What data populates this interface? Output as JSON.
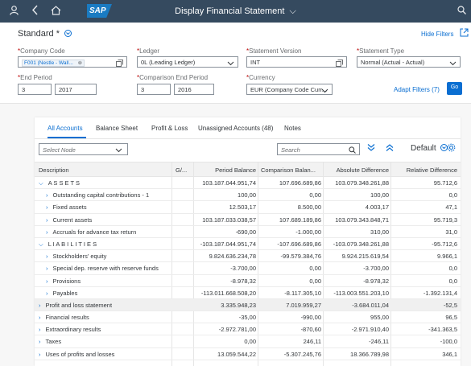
{
  "shell": {
    "title": "Display Financial Statement",
    "title_chevron": "⌵",
    "logo_text": "SAP",
    "icons": {
      "user": "user-icon",
      "back": "back-icon",
      "home": "home-icon",
      "search": "search-icon"
    }
  },
  "page": {
    "title": "Standard *",
    "title_dropdown": "⌵",
    "hide_filters": "Hide Filters",
    "share_icon": "share-icon"
  },
  "filters": {
    "company_code": {
      "label": "Company Code",
      "value": "F001 (Nestle - Wall...",
      "token_close": "⊗"
    },
    "ledger": {
      "label": "Ledger",
      "value": "0L (Leading Ledger)"
    },
    "statement_version": {
      "label": "Statement Version",
      "value": "INT"
    },
    "statement_type": {
      "label": "Statement Type",
      "value": "Normal (Actual - Actual)"
    },
    "end_period": {
      "label": "End Period",
      "period": "3",
      "year": "2017"
    },
    "comparison_end_period": {
      "label": "Comparison End Period",
      "period": "3",
      "year": "2016"
    },
    "currency": {
      "label": "Currency",
      "value": "EUR (Company Code Curr..."
    },
    "adapt_filters": "Adapt Filters (7)",
    "go": "Go",
    "required_mark": "*"
  },
  "tabs": [
    {
      "label": "All Accounts",
      "active": true
    },
    {
      "label": "Balance Sheet",
      "active": false
    },
    {
      "label": "Profit & Loss",
      "active": false
    },
    {
      "label": "Unassigned Accounts (48)",
      "active": false
    },
    {
      "label": "Notes",
      "active": false
    }
  ],
  "toolbar": {
    "select_node_placeholder": "Select Node",
    "search_placeholder": "Search",
    "variant": "Default",
    "glyphs": {
      "dropdown": "⌵",
      "search": "⌕",
      "expand_all": "⌄",
      "collapse_all": "⌃",
      "settings": "⚙",
      "variant_dd": "⊙"
    }
  },
  "table": {
    "columns": [
      "Description",
      "G/...",
      "Period Balance",
      "Comparison Balan...",
      "Absolute Difference",
      "Relative Difference"
    ],
    "rows": [
      {
        "desc": "A S S E T S",
        "level": 0,
        "chev": "⌵",
        "period": "103.187.044.951,74",
        "comparison": "107.696.689,86",
        "absolute": "103.079.348.261,88",
        "relative": "95.712,6",
        "hl": false
      },
      {
        "desc": "Outstanding capital contributions - 1",
        "level": 1,
        "chev": "›",
        "period": "100,00",
        "comparison": "0,00",
        "absolute": "100,00",
        "relative": "0,0",
        "hl": false
      },
      {
        "desc": "Fixed assets",
        "level": 1,
        "chev": "›",
        "period": "12.503,17",
        "comparison": "8.500,00",
        "absolute": "4.003,17",
        "relative": "47,1",
        "hl": false
      },
      {
        "desc": "Current assets",
        "level": 1,
        "chev": "›",
        "period": "103.187.033.038,57",
        "comparison": "107.689.189,86",
        "absolute": "103.079.343.848,71",
        "relative": "95.719,3",
        "hl": false
      },
      {
        "desc": "Accruals for advance tax return",
        "level": 1,
        "chev": "›",
        "period": "-690,00",
        "comparison": "-1.000,00",
        "absolute": "310,00",
        "relative": "31,0",
        "hl": false
      },
      {
        "desc": "L I A B I L I T I E S",
        "level": 0,
        "chev": "⌵",
        "period": "-103.187.044.951,74",
        "comparison": "-107.696.689,86",
        "absolute": "-103.079.348.261,88",
        "relative": "-95.712,6",
        "hl": false
      },
      {
        "desc": "Stockholders' equity",
        "level": 1,
        "chev": "›",
        "period": "9.824.636.234,78",
        "comparison": "-99.579.384,76",
        "absolute": "9.924.215.619,54",
        "relative": "9.966,1",
        "hl": false
      },
      {
        "desc": "Special dep. reserve with reserve funds",
        "level": 1,
        "chev": "›",
        "period": "-3.700,00",
        "comparison": "0,00",
        "absolute": "-3.700,00",
        "relative": "0,0",
        "hl": false
      },
      {
        "desc": "Provisions",
        "level": 1,
        "chev": "›",
        "period": "-8.978,32",
        "comparison": "0,00",
        "absolute": "-8.978,32",
        "relative": "0,0",
        "hl": false
      },
      {
        "desc": "Payables",
        "level": 1,
        "chev": "›",
        "period": "-113.011.668.508,20",
        "comparison": "-8.117.305,10",
        "absolute": "-113.003.551.203,10",
        "relative": "-1.392.131,4",
        "hl": false
      },
      {
        "desc": "Profit and loss statement",
        "level": 0,
        "chev": "›",
        "period": "3.335.948,23",
        "comparison": "7.019.959,27",
        "absolute": "-3.684.011,04",
        "relative": "-52,5",
        "hl": true
      },
      {
        "desc": "Financial results",
        "level": 0,
        "chev": "›",
        "period": "-35,00",
        "comparison": "-990,00",
        "absolute": "955,00",
        "relative": "96,5",
        "hl": false
      },
      {
        "desc": "Extraordinary results",
        "level": 0,
        "chev": "›",
        "period": "-2.972.781,00",
        "comparison": "-870,60",
        "absolute": "-2.971.910,40",
        "relative": "-341.363,5",
        "hl": false
      },
      {
        "desc": "Taxes",
        "level": 0,
        "chev": "›",
        "period": "0,00",
        "comparison": "246,11",
        "absolute": "-246,11",
        "relative": "-100,0",
        "hl": false
      },
      {
        "desc": "Uses of profits and losses",
        "level": 0,
        "chev": "›",
        "period": "13.059.544,22",
        "comparison": "-5.307.245,76",
        "absolute": "18.366.789,98",
        "relative": "346,1",
        "hl": false
      }
    ]
  }
}
